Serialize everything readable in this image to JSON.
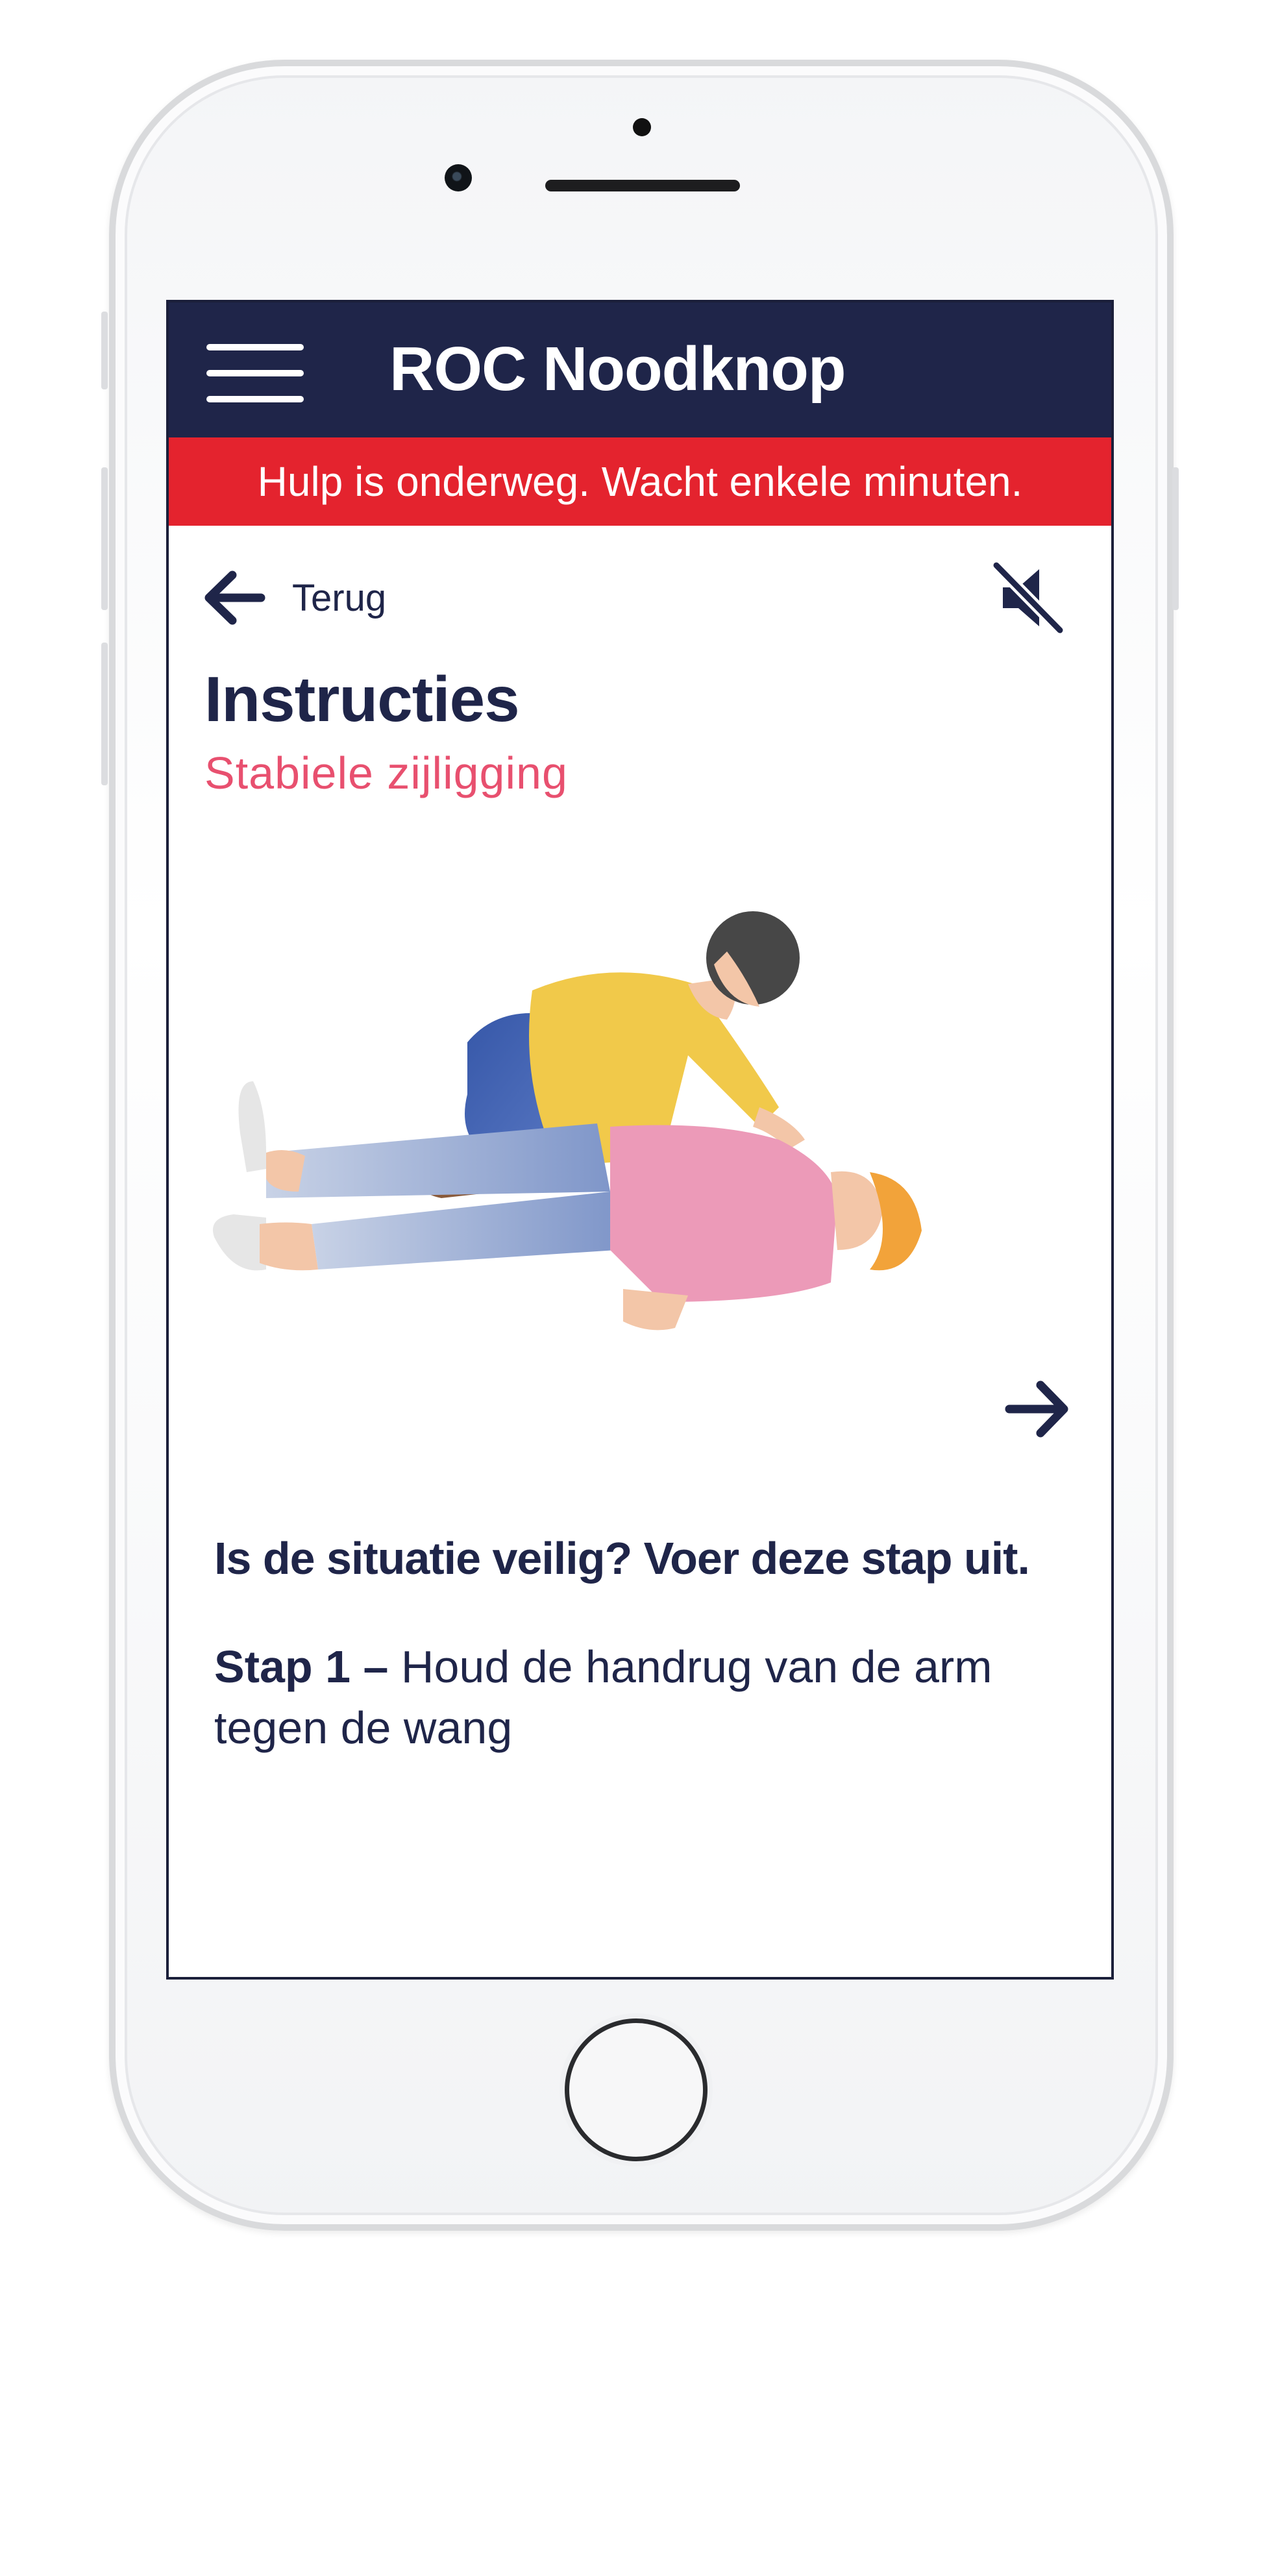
{
  "app": {
    "title": "ROC Noodknop",
    "accent_color": "#1f2549",
    "alert_color": "#e4232e",
    "subtitle_color": "#e8506f"
  },
  "banner": {
    "text": "Hulp is onderweg. Wacht enkele minuten."
  },
  "nav": {
    "back_label": "Terug",
    "back_icon": "arrow-left-icon",
    "mute_icon": "speaker-muted-icon",
    "menu_icon": "hamburger-menu-icon"
  },
  "content": {
    "title": "Instructies",
    "subtitle": "Stabiele zijligging",
    "next_icon": "arrow-right-icon",
    "question": "Is de situatie veilig? Voer deze stap uit.",
    "step_label": "Stap 1 –",
    "step_text": " Houd de handrug van de arm tegen de wang"
  }
}
